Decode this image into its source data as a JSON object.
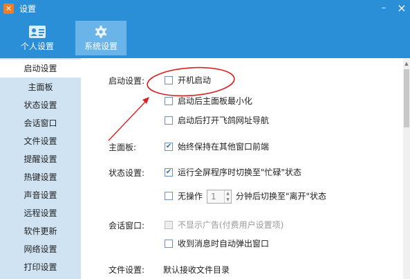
{
  "window": {
    "title": "设置",
    "app_icon_glyph": "✕",
    "minimize_glyph": "–",
    "close_glyph": "×"
  },
  "tabs": [
    {
      "label": "个人设置",
      "icon": "contact-card-icon"
    },
    {
      "label": "系统设置",
      "icon": "gear-icon",
      "active": true
    }
  ],
  "sidebar": {
    "items": [
      {
        "label": "启动设置",
        "active": true
      },
      {
        "label": "主面板"
      },
      {
        "label": "状态设置"
      },
      {
        "label": "会话窗口"
      },
      {
        "label": "文件设置"
      },
      {
        "label": "提醒设置"
      },
      {
        "label": "热键设置"
      },
      {
        "label": "声音设置"
      },
      {
        "label": "远程设置"
      },
      {
        "label": "软件更新"
      },
      {
        "label": "网络设置"
      },
      {
        "label": "打印设置"
      }
    ]
  },
  "sections": {
    "startup": {
      "label": "启动设置:",
      "options": [
        {
          "label": "开机启动",
          "checked": false
        },
        {
          "label": "启动后主面板最小化",
          "checked": false
        },
        {
          "label": "启动后打开飞鸽网址导航",
          "checked": false
        }
      ]
    },
    "main_panel": {
      "label": "主面板:",
      "options": [
        {
          "label": "始终保持在其他窗口前端",
          "checked": true
        }
      ]
    },
    "status": {
      "label": "状态设置:",
      "options": [
        {
          "label": "运行全屏程序时切换至\"忙碌\"状态",
          "checked": true
        }
      ],
      "idle": {
        "prefix": "无操作",
        "minutes": "1",
        "suffix": "分钟后切换至\"离开\"状态",
        "checked": false
      }
    },
    "chat_window": {
      "label": "会话窗口:",
      "options": [
        {
          "label": "不显示广告(付费用户设置项)",
          "checked": false,
          "disabled": true
        },
        {
          "label": "收到消息时自动弹出窗口",
          "checked": false
        }
      ]
    },
    "file": {
      "label": "文件设置:",
      "default_dir_label": "默认接收文件目录"
    }
  },
  "colors": {
    "titlebar": "#2b8fd8",
    "active_tab": "#6ab4ea",
    "sidebar": "#cfe3f3",
    "annotation": "#d92020"
  },
  "check_glyph": "✔"
}
